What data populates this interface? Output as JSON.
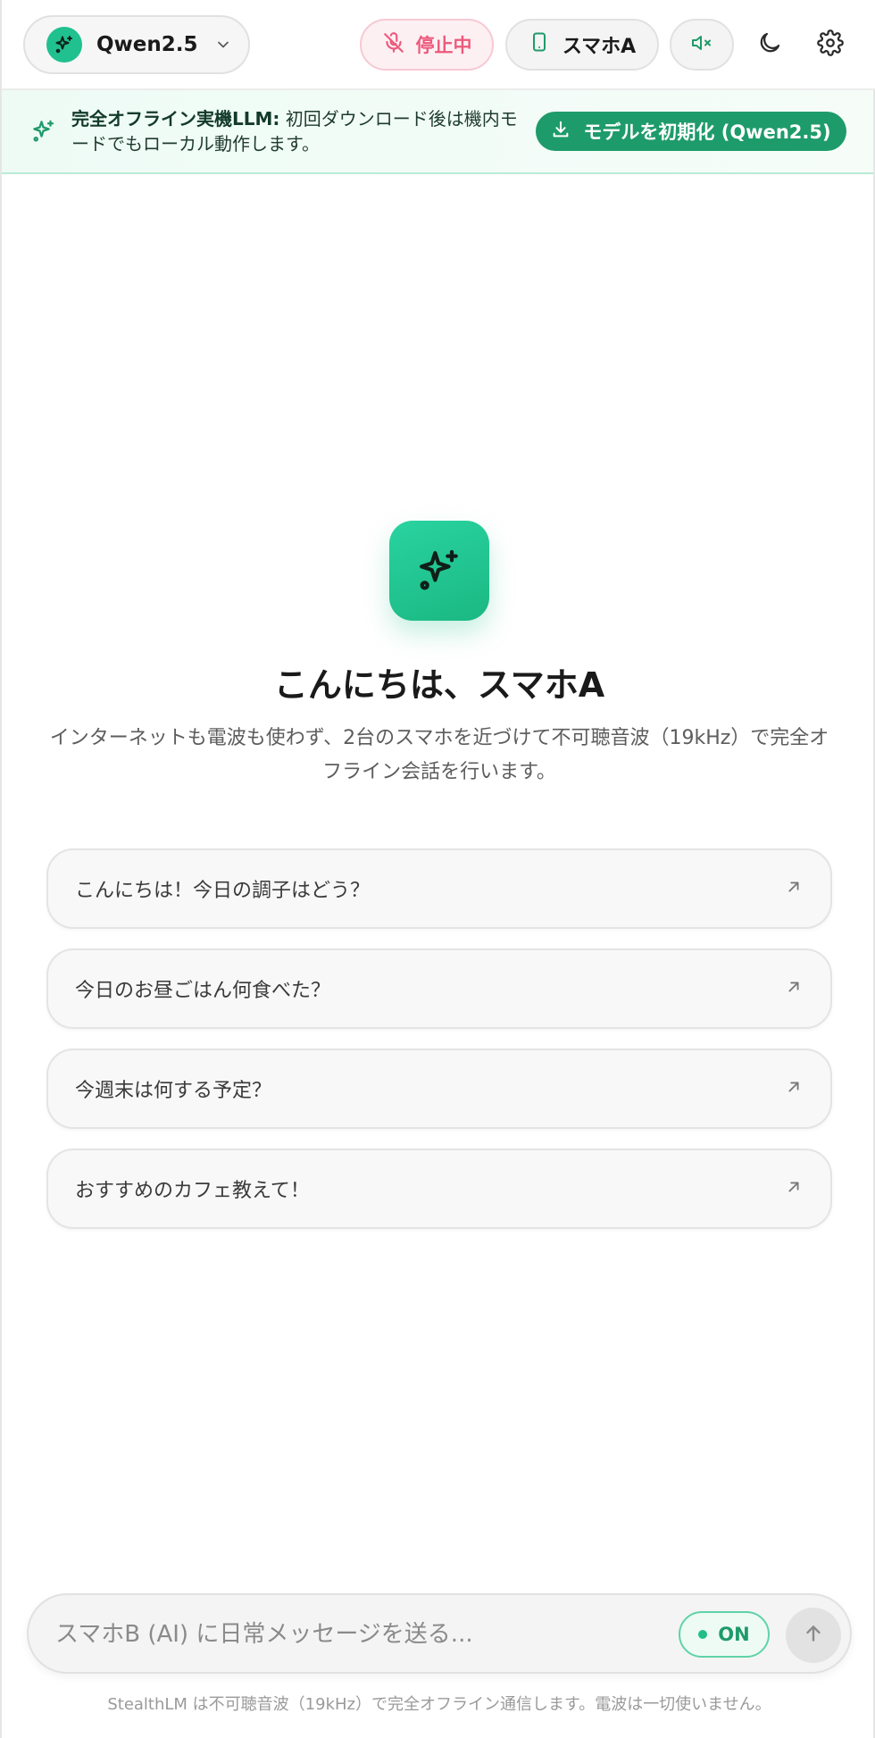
{
  "header": {
    "model_name": "Qwen2.5",
    "mic_status_label": "停止中",
    "device_label": "スマホA"
  },
  "banner": {
    "title": "完全オフライン実機LLM:",
    "text": "初回ダウンロード後は機内モードでもローカル動作します。",
    "button_label": "モデルを初期化 (Qwen2.5)"
  },
  "hero": {
    "greeting": "こんにちは、スマホA",
    "subtitle": "インターネットも電波も使わず、2台のスマホを近づけて不可聴音波（19kHz）で完全オフライン会話を行います。"
  },
  "suggestions": [
    "こんにちは！今日の調子はどう？",
    "今日のお昼ごはん何食べた？",
    "今週末は何する予定？",
    "おすすめのカフェ教えて！"
  ],
  "composer": {
    "placeholder": "スマホB (AI) に日常メッセージを送る...",
    "value": "",
    "toggle_label": "ON"
  },
  "footer": {
    "note": "StealthLM は不可聴音波（19kHz）で完全オフライン通信します。電波は一切使いません。"
  },
  "icons": {
    "model": "sparkles-icon",
    "mic": "mic-off-icon",
    "device": "smartphone-icon",
    "volume": "volume-mute-icon",
    "theme": "moon-icon",
    "settings": "gear-icon",
    "download": "download-icon",
    "suggestion_arrow": "arrow-up-right-icon",
    "send": "arrow-up-icon"
  },
  "colors": {
    "accent": "#20c08f",
    "accent_dark": "#1e9b6a",
    "status_red": "#ec5a7c"
  }
}
